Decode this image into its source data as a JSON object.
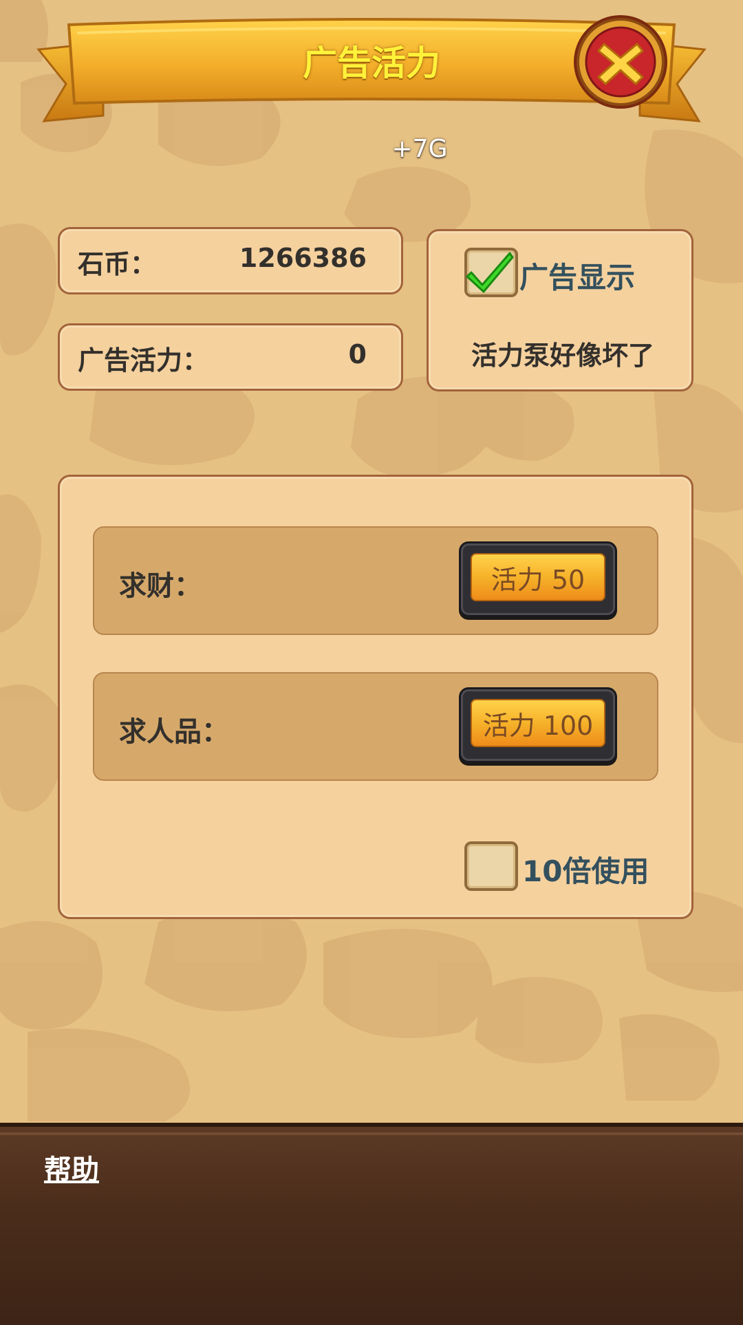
{
  "title": "广告活力",
  "reward": "+7G",
  "stats": {
    "coins_label": "石币：",
    "coins_value": "1266386",
    "vitality_label": "广告活力：",
    "vitality_value": "0"
  },
  "ad_display": {
    "label": "广告显示",
    "checked": true,
    "status": "活力泵好像坏了"
  },
  "actions": [
    {
      "label": "求财：",
      "button": "活力 50"
    },
    {
      "label": "求人品：",
      "button": "活力 100"
    }
  ],
  "multiplier": {
    "label": "10倍使用",
    "checked": false
  },
  "footer": {
    "help": "帮助"
  },
  "colors": {
    "background": "#e6c184",
    "panel": "#f5d19e",
    "title": "#fff23a",
    "button": "#f6b22a",
    "footer": "#4b2d1b"
  },
  "icons": [
    "close-icon",
    "checkmark-icon"
  ]
}
